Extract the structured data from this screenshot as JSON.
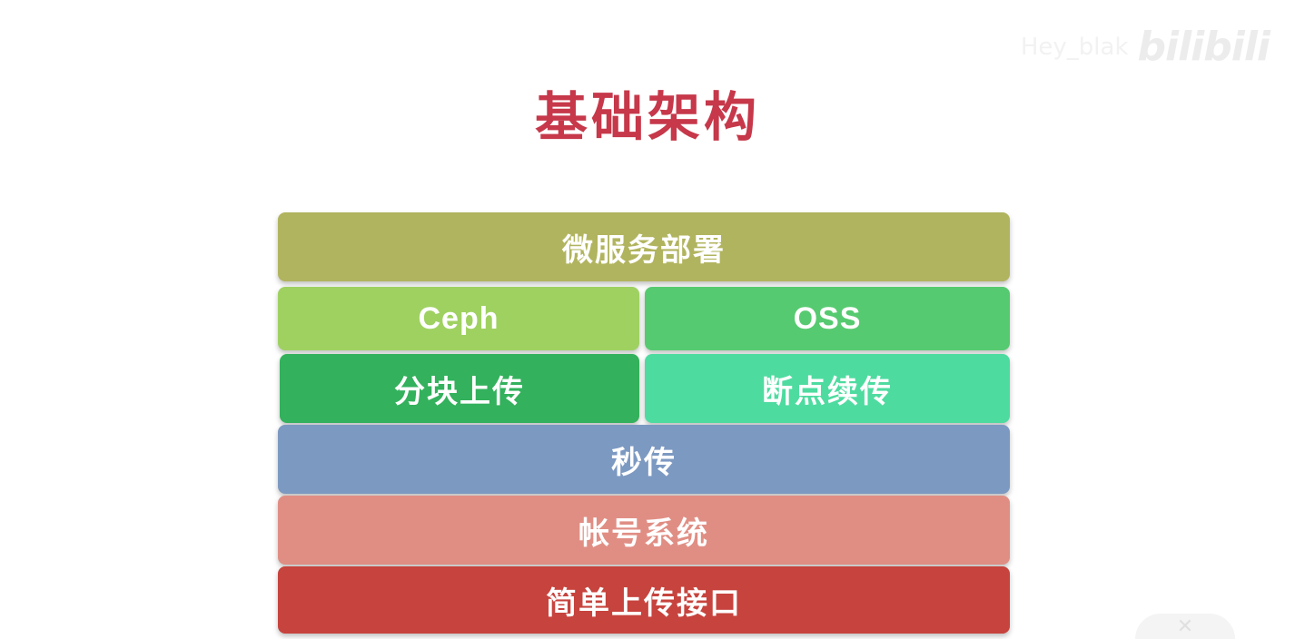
{
  "title": "基础架构",
  "watermark": {
    "user": "Hey_blak",
    "logo": "bilibili"
  },
  "layers": {
    "deploy": "微服务部署",
    "ceph": "Ceph",
    "oss": "OSS",
    "chunk_upload": "分块上传",
    "resume_upload": "断点续传",
    "instant_upload": "秒传",
    "account_system": "帐号系统",
    "simple_upload": "简单上传接口"
  },
  "colors": {
    "title": "#c6384a",
    "deploy": "#b1b45e",
    "ceph": "#9fd161",
    "oss": "#56ca70",
    "chunk_upload": "#33b15c",
    "resume_upload": "#4edba0",
    "instant_upload": "#7c99c1",
    "account_system": "#e08e84",
    "simple_upload": "#c7433d"
  },
  "icons": {
    "corner": "bilibili-tv-icon"
  }
}
